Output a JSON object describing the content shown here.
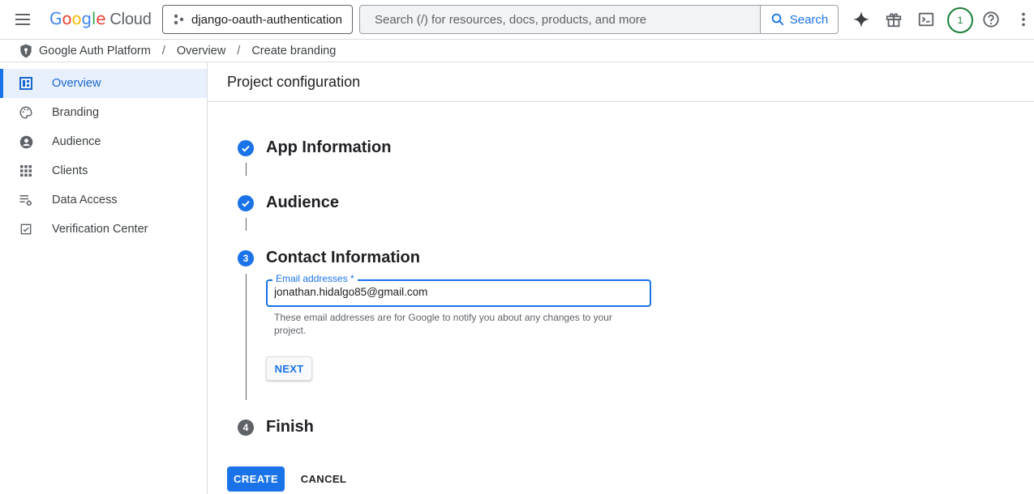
{
  "topbar": {
    "logo_google": "Google",
    "logo_cloud": "Cloud",
    "project_name": "django-oauth-authentication",
    "search_placeholder": "Search (/) for resources, docs, products, and more",
    "search_button": "Search",
    "notification_count": "1"
  },
  "breadcrumb": {
    "items": [
      "Google Auth Platform",
      "Overview",
      "Create branding"
    ]
  },
  "sidebar": {
    "items": [
      {
        "label": "Overview",
        "icon": "dashboard-icon",
        "active": true
      },
      {
        "label": "Branding",
        "icon": "palette-icon"
      },
      {
        "label": "Audience",
        "icon": "account-circle-icon"
      },
      {
        "label": "Clients",
        "icon": "apps-grid-icon"
      },
      {
        "label": "Data Access",
        "icon": "data-settings-icon"
      },
      {
        "label": "Verification Center",
        "icon": "verified-check-icon"
      }
    ]
  },
  "main": {
    "title": "Project configuration",
    "steps": [
      {
        "number": "1",
        "title": "App Information",
        "state": "done"
      },
      {
        "number": "2",
        "title": "Audience",
        "state": "done"
      },
      {
        "number": "3",
        "title": "Contact Information",
        "state": "current"
      },
      {
        "number": "4",
        "title": "Finish",
        "state": "todo"
      }
    ],
    "email_field": {
      "label": "Email addresses *",
      "value": "jonathan.hidalgo85@gmail.com",
      "helper": "These email addresses are for Google to notify you about any changes to your project."
    },
    "next_button": "NEXT",
    "create_button": "CREATE",
    "cancel_button": "CANCEL"
  },
  "colors": {
    "accent": "#1a73e8",
    "active_bg": "#e8f0fe",
    "badge": "#188038"
  }
}
